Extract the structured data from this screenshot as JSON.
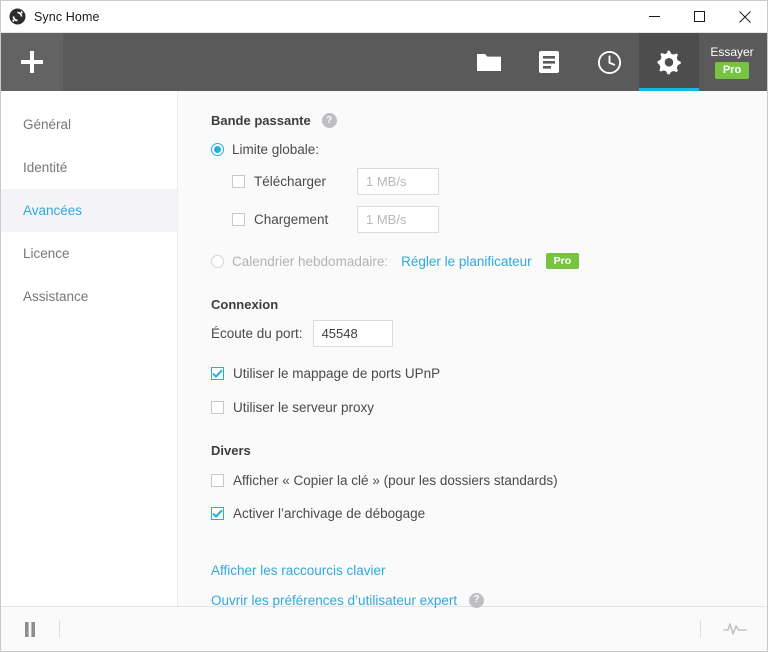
{
  "window": {
    "title": "Sync Home",
    "app_icon": "sync-icon",
    "controls": {
      "minimize": "minimize-icon",
      "maximize": "maximize-icon",
      "close": "close-icon"
    }
  },
  "toolbar": {
    "add_label": "+",
    "tabs": [
      {
        "icon": "folder-icon",
        "name": "folders",
        "active": false
      },
      {
        "icon": "document-list-icon",
        "name": "transfers",
        "active": false
      },
      {
        "icon": "clock-history-icon",
        "name": "history",
        "active": false
      },
      {
        "icon": "gear-icon",
        "name": "settings",
        "active": true
      }
    ],
    "try_pro": {
      "label": "Essayer",
      "badge": "Pro"
    }
  },
  "sidebar": {
    "items": [
      {
        "label": "Général",
        "active": false
      },
      {
        "label": "Identité",
        "active": false
      },
      {
        "label": "Avancées",
        "active": true
      },
      {
        "label": "Licence",
        "active": false
      },
      {
        "label": "Assistance",
        "active": false
      }
    ]
  },
  "settings": {
    "bandwidth": {
      "heading": "Bande passante",
      "help": "?",
      "global_limit_label": "Limite globale:",
      "global_limit_selected": true,
      "download": {
        "label": "Télécharger",
        "checked": false,
        "value": "",
        "placeholder": "1 MB/s"
      },
      "upload": {
        "label": "Chargement",
        "checked": false,
        "value": "",
        "placeholder": "1 MB/s"
      },
      "schedule": {
        "label": "Calendrier hebdomadaire:",
        "selected": false,
        "link": "Régler le planificateur",
        "badge": "Pro"
      }
    },
    "connection": {
      "heading": "Connexion",
      "port_label": "Écoute du port:",
      "port_value": "45548",
      "upnp": {
        "label": "Utiliser le mappage de ports UPnP",
        "checked": true
      },
      "proxy": {
        "label": "Utiliser le serveur proxy",
        "checked": false
      }
    },
    "misc": {
      "heading": "Divers",
      "copy_key": {
        "label": "Afficher « Copier la clé » (pour les dossiers standards)",
        "checked": false
      },
      "debug_log": {
        "label": "Activer l’archivage de débogage",
        "checked": true
      }
    },
    "links": {
      "shortcuts": "Afficher les raccourcis clavier",
      "power_user": "Ouvrir les préférences d’utilisateur expert",
      "power_user_help": "?"
    }
  },
  "statusbar": {
    "pause_icon": "pause-icon",
    "activity_icon": "activity-pulse-icon"
  },
  "colors": {
    "accent": "#31a9dd",
    "accent_bright": "#18b4e9",
    "pro_green": "#76c442",
    "toolbar": "#5a5a5a"
  }
}
